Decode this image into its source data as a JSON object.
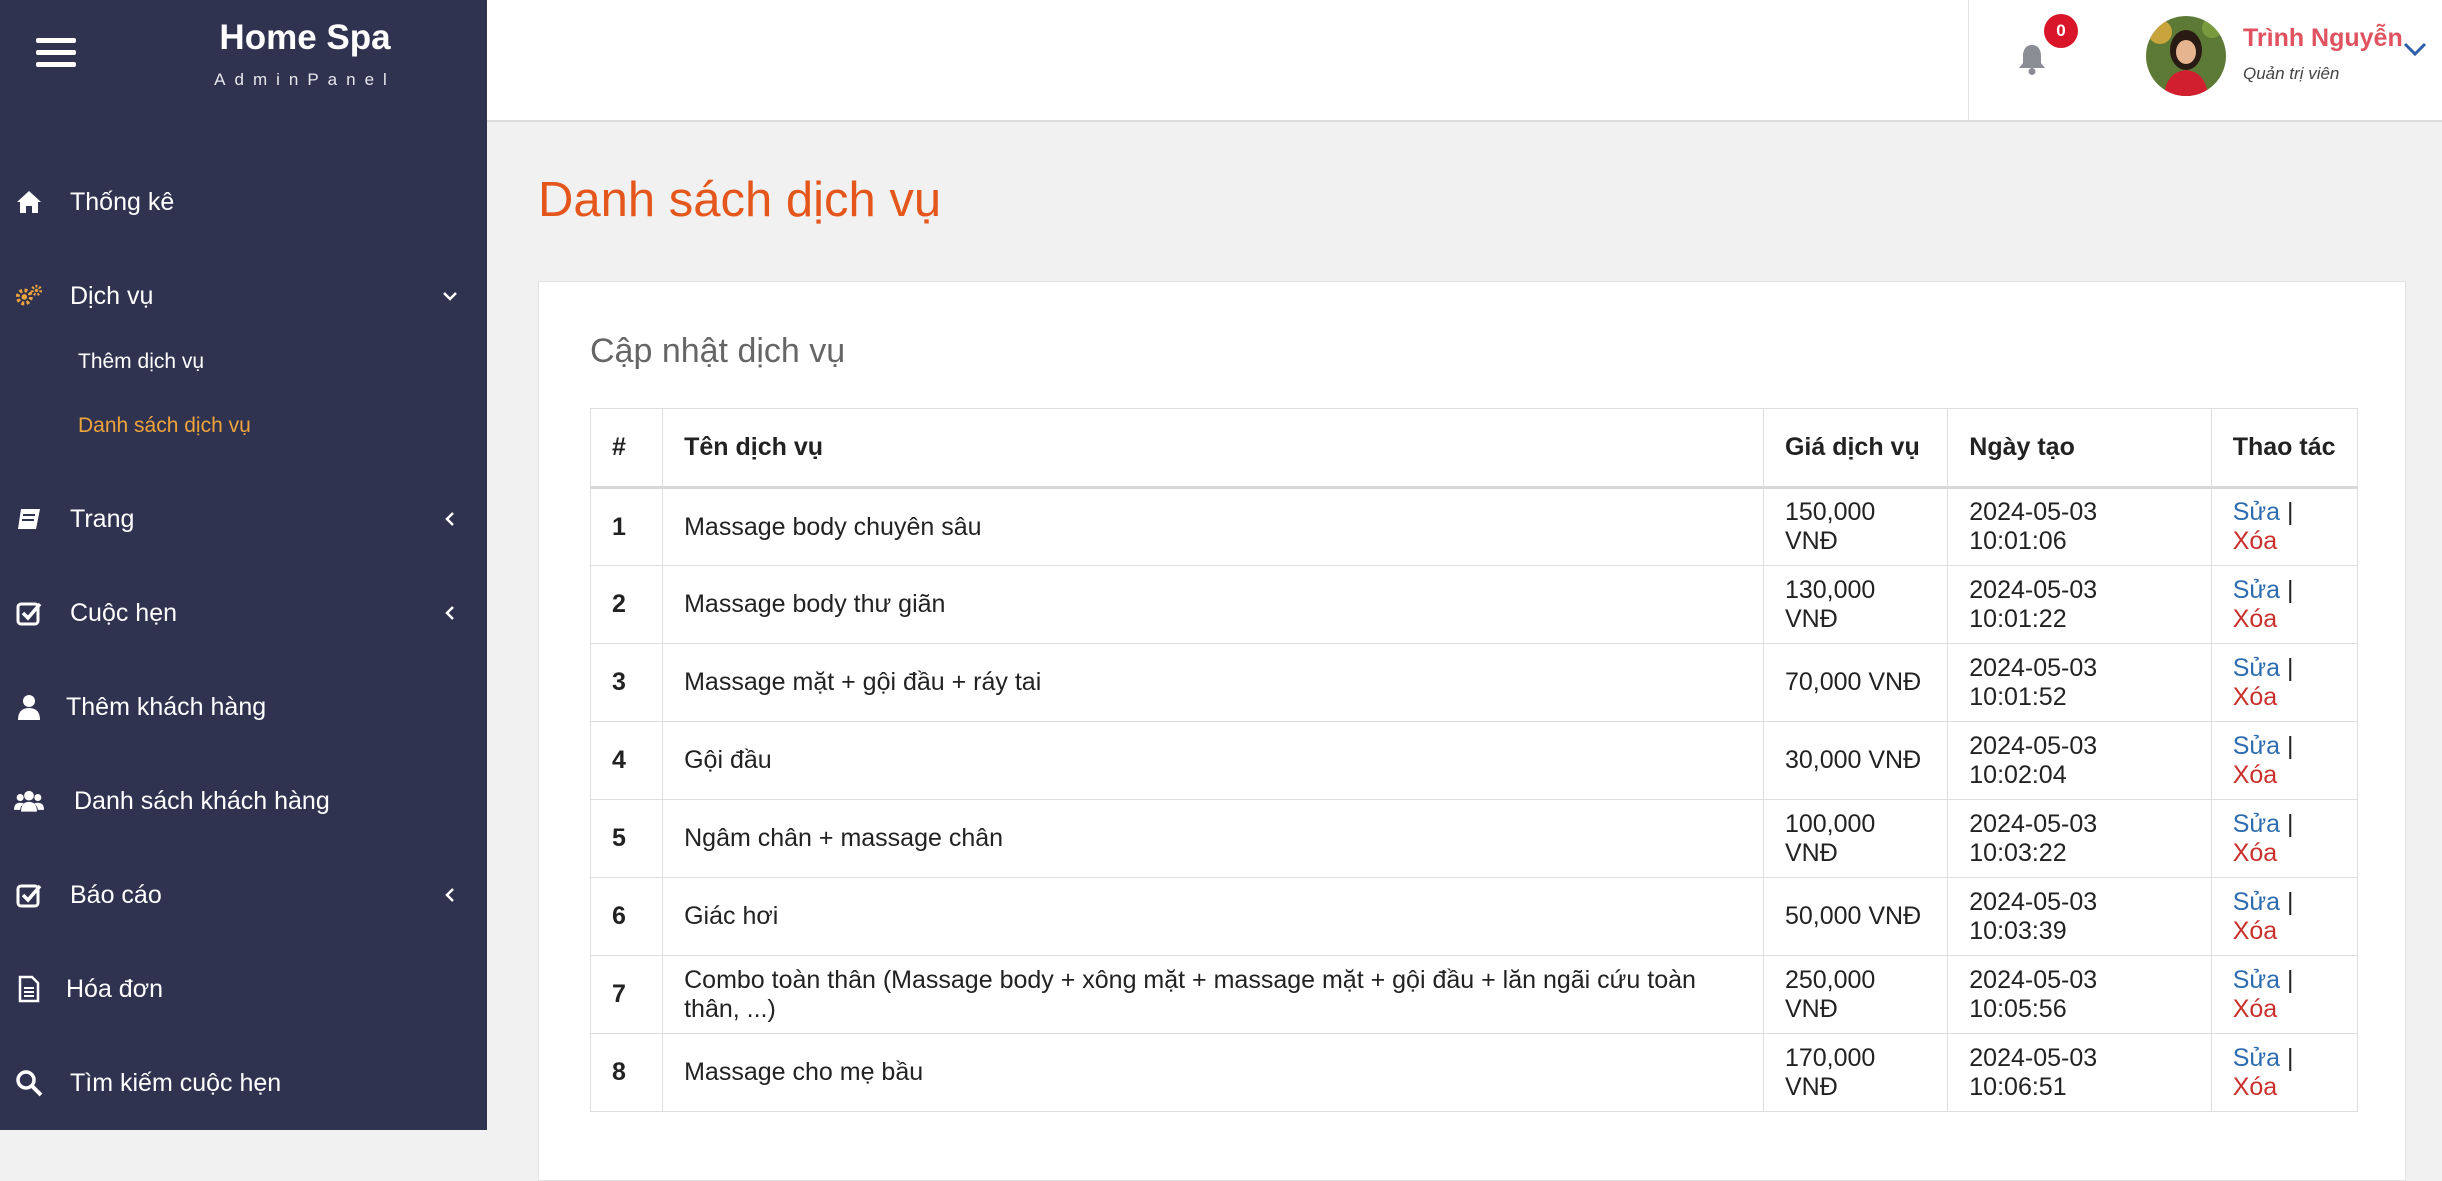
{
  "brand": {
    "title": "Home Spa",
    "subtitle": "AdminPanel"
  },
  "sidebar": {
    "items": [
      {
        "label": "Thống kê",
        "icon": "home-icon"
      },
      {
        "label": "Dịch vụ",
        "icon": "gears-icon",
        "expanded": true,
        "children": [
          {
            "label": "Thêm dịch vụ"
          },
          {
            "label": "Danh sách dịch vụ",
            "active": true
          }
        ]
      },
      {
        "label": "Trang",
        "icon": "book-icon"
      },
      {
        "label": "Cuộc hẹn",
        "icon": "check-square-icon"
      },
      {
        "label": "Thêm khách hàng",
        "icon": "user-icon"
      },
      {
        "label": "Danh sách khách hàng",
        "icon": "users-icon"
      },
      {
        "label": "Báo cáo",
        "icon": "check-square-icon"
      },
      {
        "label": "Hóa đơn",
        "icon": "file-text-icon"
      },
      {
        "label": "Tìm kiếm cuộc hẹn",
        "icon": "search-icon"
      }
    ]
  },
  "topbar": {
    "notification_count": "0",
    "user": {
      "name": "Trình Nguyễn",
      "role": "Quản trị viên"
    }
  },
  "colors": {
    "sidebar": "#2f3350",
    "accent": "#f0a33a",
    "title": "#e4561b",
    "user": "#e0525f",
    "badge": "#d9152a"
  },
  "main": {
    "page_title": "Danh sách dịch vụ",
    "card_title": "Cập nhật dịch vụ",
    "table": {
      "headers": [
        "#",
        "Tên dịch vụ",
        "Giá dịch vụ",
        "Ngày tạo",
        "Thao tác"
      ],
      "rows": [
        {
          "num": "1",
          "name": "Massage body chuyên sâu",
          "price": "150,000 VNĐ",
          "created": "2024-05-03 10:01:06"
        },
        {
          "num": "2",
          "name": "Massage body thư giãn",
          "price": "130,000 VNĐ",
          "created": "2024-05-03 10:01:22"
        },
        {
          "num": "3",
          "name": "Massage mặt + gội đầu + ráy tai",
          "price": "70,000 VNĐ",
          "created": "2024-05-03 10:01:52"
        },
        {
          "num": "4",
          "name": "Gội đầu",
          "price": "30,000 VNĐ",
          "created": "2024-05-03 10:02:04"
        },
        {
          "num": "5",
          "name": "Ngâm chân + massage chân",
          "price": "100,000 VNĐ",
          "created": "2024-05-03 10:03:22"
        },
        {
          "num": "6",
          "name": "Giác hơi",
          "price": "50,000 VNĐ",
          "created": "2024-05-03 10:03:39"
        },
        {
          "num": "7",
          "name": "Combo toàn thân (Massage body + xông mặt + massage mặt + gội đầu + lăn ngãi cứu toàn thân, ...)",
          "price": "250,000 VNĐ",
          "created": "2024-05-03 10:05:56"
        },
        {
          "num": "8",
          "name": "Massage cho mẹ bầu",
          "price": "170,000 VNĐ",
          "created": "2024-05-03 10:06:51"
        }
      ],
      "edit_label": "Sửa",
      "delete_label": "Xóa",
      "separator": "|"
    }
  }
}
